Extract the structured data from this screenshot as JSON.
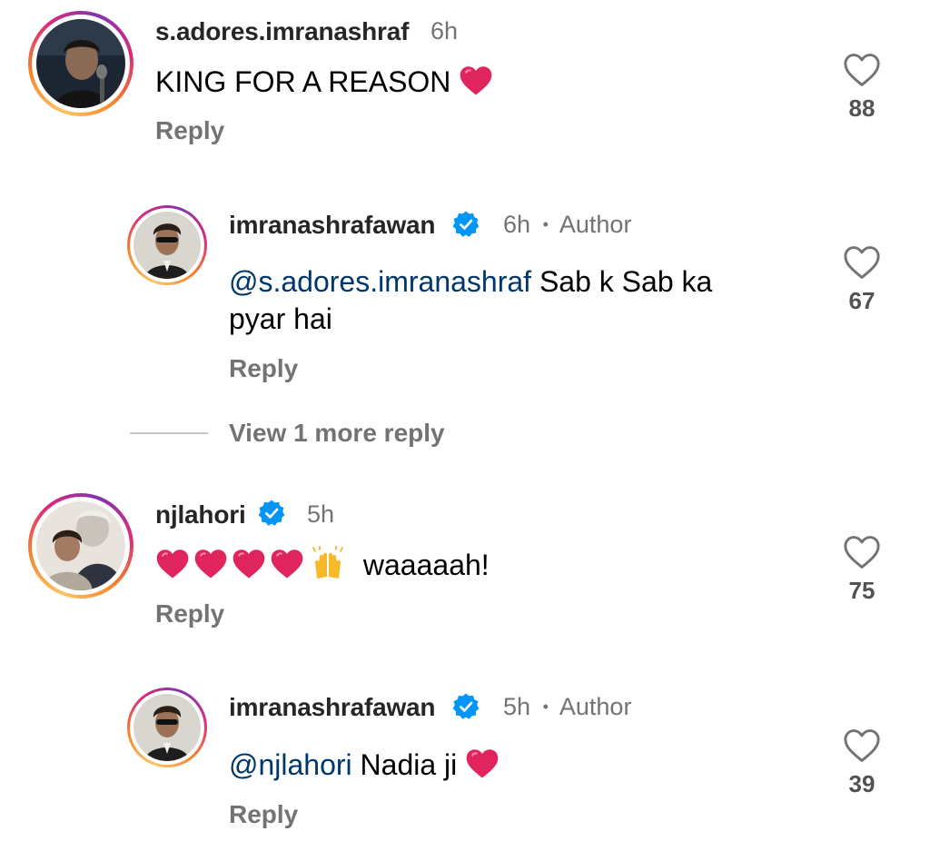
{
  "comments": [
    {
      "username": "s.adores.imranashraf",
      "time": "6h",
      "text": "KING FOR A REASON",
      "reply_label": "Reply",
      "likes": "88",
      "replies": [
        {
          "username": "imranashrafawan",
          "verified": true,
          "time": "6h",
          "author_label": "Author",
          "mention": "@s.adores.imranashraf",
          "text_line1": " Sab k Sab ka",
          "text_line2": "pyar hai",
          "reply_label": "Reply",
          "likes": "67"
        }
      ],
      "view_more": "View 1 more reply"
    },
    {
      "username": "njlahori",
      "verified": true,
      "time": "5h",
      "text": "waaaaah!",
      "reply_label": "Reply",
      "likes": "75",
      "replies": [
        {
          "username": "imranashrafawan",
          "verified": true,
          "time": "5h",
          "author_label": "Author",
          "mention": "@njlahori",
          "text": " Nadia ji",
          "reply_label": "Reply",
          "likes": "39"
        }
      ]
    }
  ],
  "separator": "•",
  "colors": {
    "username": "#262626",
    "secondary": "#737373",
    "mention": "#00376b",
    "verified": "#0095f6",
    "heart_emoji": "#e0245e"
  },
  "icons": [
    "heart-outline-icon",
    "verified-badge-icon",
    "red-heart-emoji",
    "raising-hands-emoji"
  ]
}
